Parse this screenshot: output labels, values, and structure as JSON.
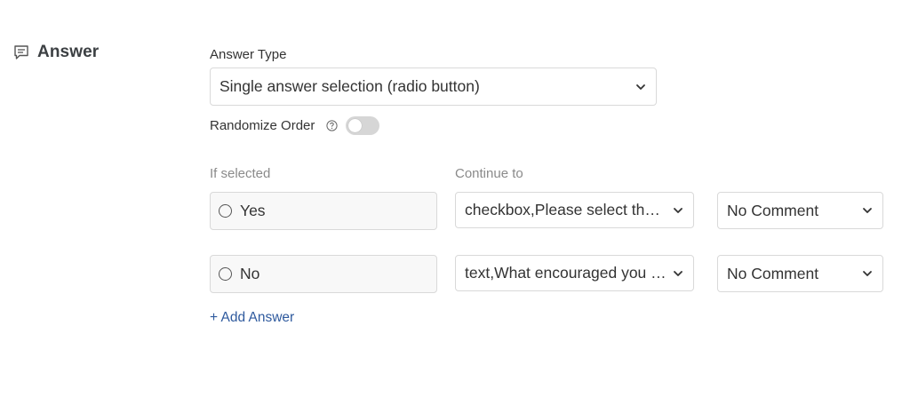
{
  "section": {
    "title": "Answer",
    "icon": "comment-icon"
  },
  "answer_type": {
    "label": "Answer Type",
    "selected": "Single answer selection (radio button)"
  },
  "randomize": {
    "label": "Randomize Order",
    "enabled": false
  },
  "columns": {
    "if_selected": "If selected",
    "continue_to": "Continue to"
  },
  "answers": [
    {
      "text": "Yes",
      "continue_to": "checkbox,Please select the ...",
      "comment": "No Comment"
    },
    {
      "text": "No",
      "continue_to": "text,What encouraged you t...",
      "comment": "No Comment"
    }
  ],
  "add_answer_label": "+ Add Answer",
  "colors": {
    "link": "#2f5a9e",
    "border": "#d9d9d9",
    "toggle_off": "#d6d6d6",
    "muted_label": "#8a8a8a"
  }
}
